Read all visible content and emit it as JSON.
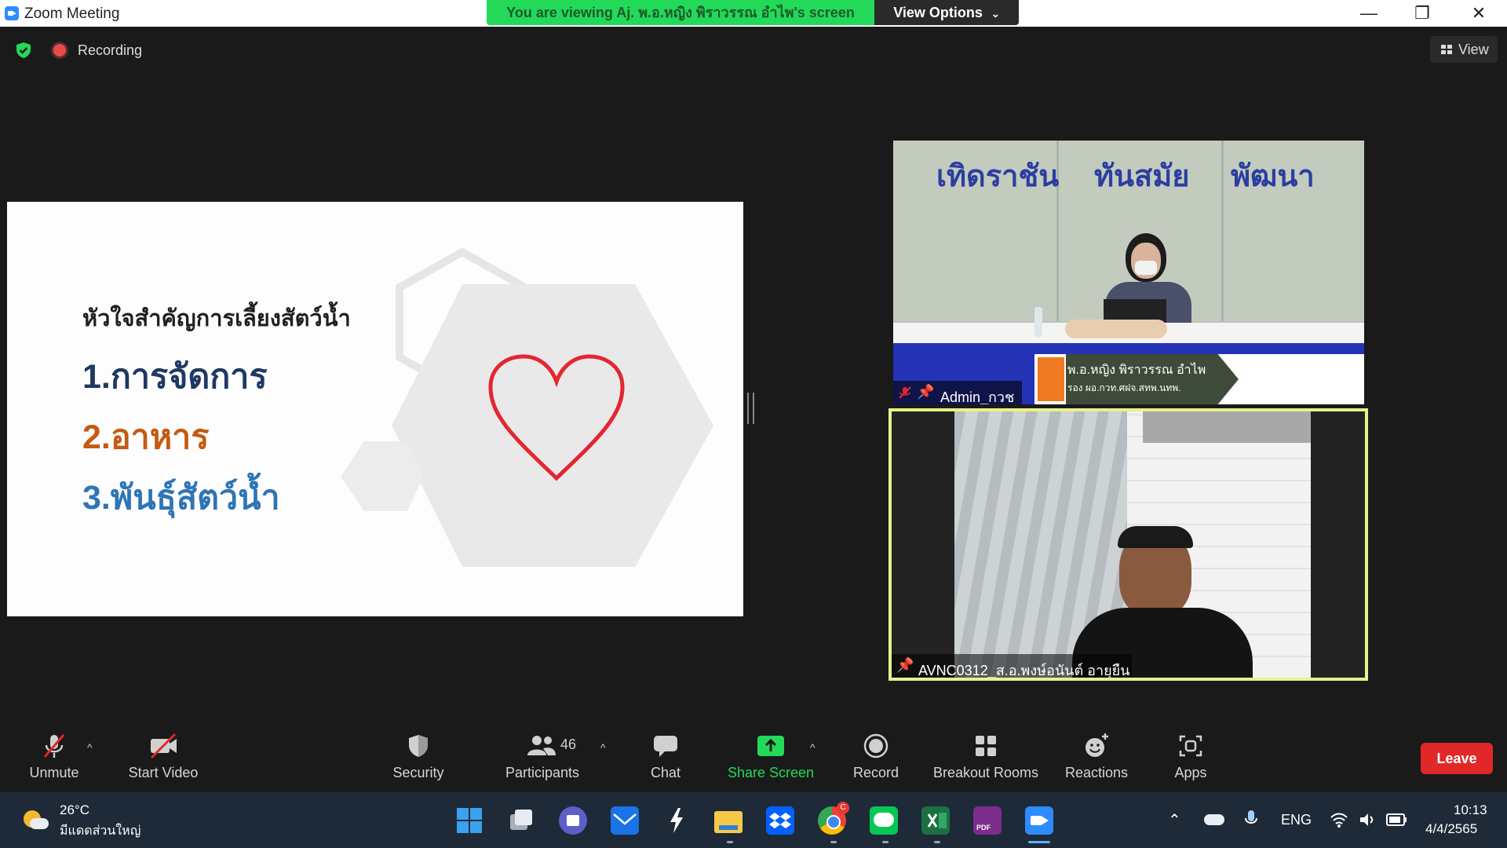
{
  "window": {
    "title": "Zoom Meeting",
    "share_banner": "You are viewing Aj. พ.อ.หญิง พิราวรรณ  อำไพ's screen",
    "view_options_label": "View Options",
    "minimize_glyph": "—",
    "restore_glyph": "❐",
    "close_glyph": "✕"
  },
  "header": {
    "recording_label": "Recording",
    "view_label": "View"
  },
  "slide": {
    "title": "หัวใจสำคัญการเลี้ยงสัตว์น้ำ",
    "items": [
      "1.การจัดการ",
      "2.อาหาร",
      "3.พันธุ์สัตว์น้ำ"
    ],
    "colors": {
      "item1": "#1f3864",
      "item2": "#c55a11",
      "item3": "#2e75b6",
      "heart": "#e32630"
    }
  },
  "videos": [
    {
      "participant": "Admin_กวช",
      "backdrop_text": [
        "เทิดราชัน",
        "ทันสมัย",
        "พัฒนา"
      ],
      "nameplate": [
        "พ.อ.หญิง พิราวรรณ  อำไพ",
        "รอง ผอ.กวท.ศฝจ.สทพ.นทพ."
      ],
      "muted": true,
      "pinned": true
    },
    {
      "participant": "AVNC0312_ส.อ.พงษ์อนันต์ อายุยืน",
      "active_speaker": true,
      "pinned": true
    }
  ],
  "toolbar": {
    "unmute": "Unmute",
    "start_video": "Start Video",
    "security": "Security",
    "participants": "Participants",
    "participants_count": "46",
    "chat": "Chat",
    "share_screen": "Share Screen",
    "record": "Record",
    "breakout_rooms": "Breakout Rooms",
    "reactions": "Reactions",
    "apps": "Apps",
    "leave": "Leave",
    "share_color": "#23d959",
    "leave_color": "#e02828"
  },
  "taskbar": {
    "weather_temp": "26°C",
    "weather_desc": "มีแดดส่วนใหญ่",
    "language": "ENG",
    "time": "10:13",
    "date": "4/4/2565",
    "chrome_badge": "C",
    "pdf_label": "PDF",
    "apps": [
      "start",
      "task-view",
      "teams",
      "mail",
      "app",
      "file-explorer",
      "dropbox",
      "chrome",
      "line",
      "excel",
      "pdf",
      "zoom"
    ]
  }
}
